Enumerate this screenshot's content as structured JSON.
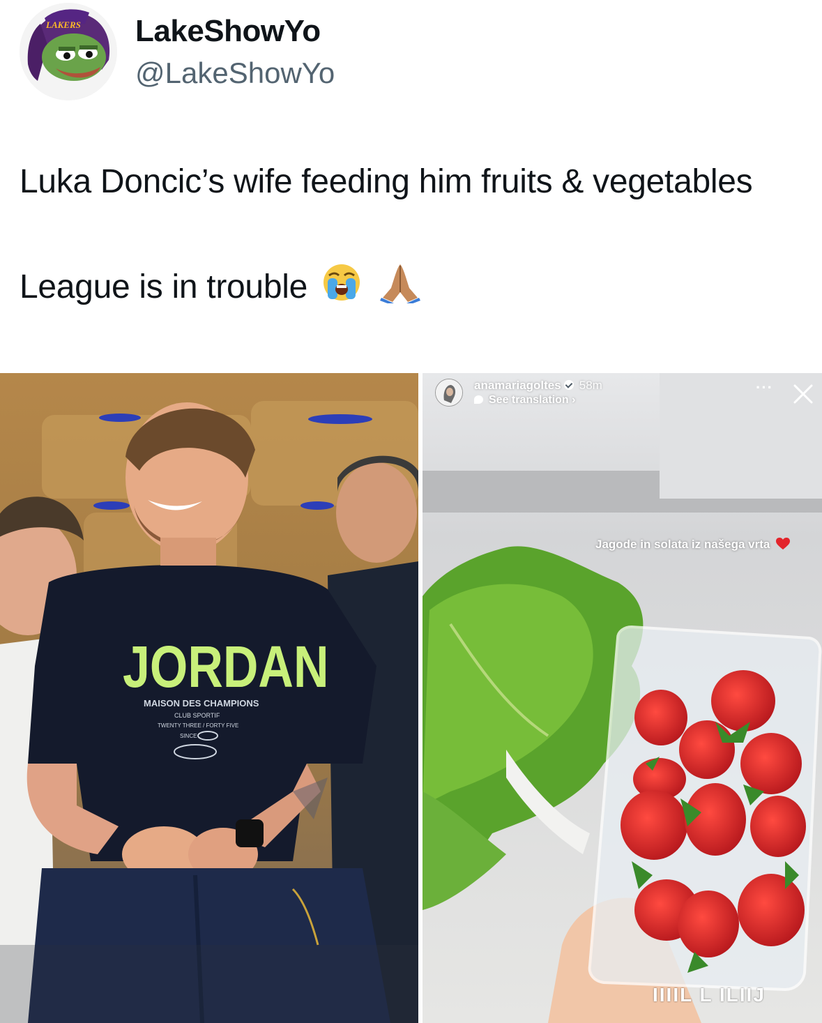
{
  "author": {
    "display_name": "LakeShowYo",
    "handle": "@LakeShowYo",
    "avatar": "pepe-lakers-avatar",
    "avatar_cap_text": "LAKERS"
  },
  "tweet": {
    "line1": "Luka Doncic’s wife feeding him fruits & vegetables",
    "line2": "League is in trouble",
    "emojis": [
      "loudly-crying-face-icon",
      "folded-hands-icon"
    ]
  },
  "media_left": {
    "shirt_brand": "JORDAN",
    "shirt_sub1": "MAISON DES CHAMPIONS",
    "shirt_sub2": "CLUB SPORTIF",
    "shirt_sub3": "TWENTY THREE / FORTY FIVE",
    "shirt_sub4": "SINCE"
  },
  "media_right": {
    "story_username": "anamariagoltes",
    "story_time": "58m",
    "see_translation": "See translation ›",
    "more_label": "···",
    "caption": "Jagode in solata iz našega vrta",
    "watermark": "IIIIL L ILIIJ"
  },
  "colors": {
    "text_primary": "#0f1419",
    "text_secondary": "#536471",
    "lakers_purple": "#552583",
    "shirt_green": "#c8f07a"
  }
}
